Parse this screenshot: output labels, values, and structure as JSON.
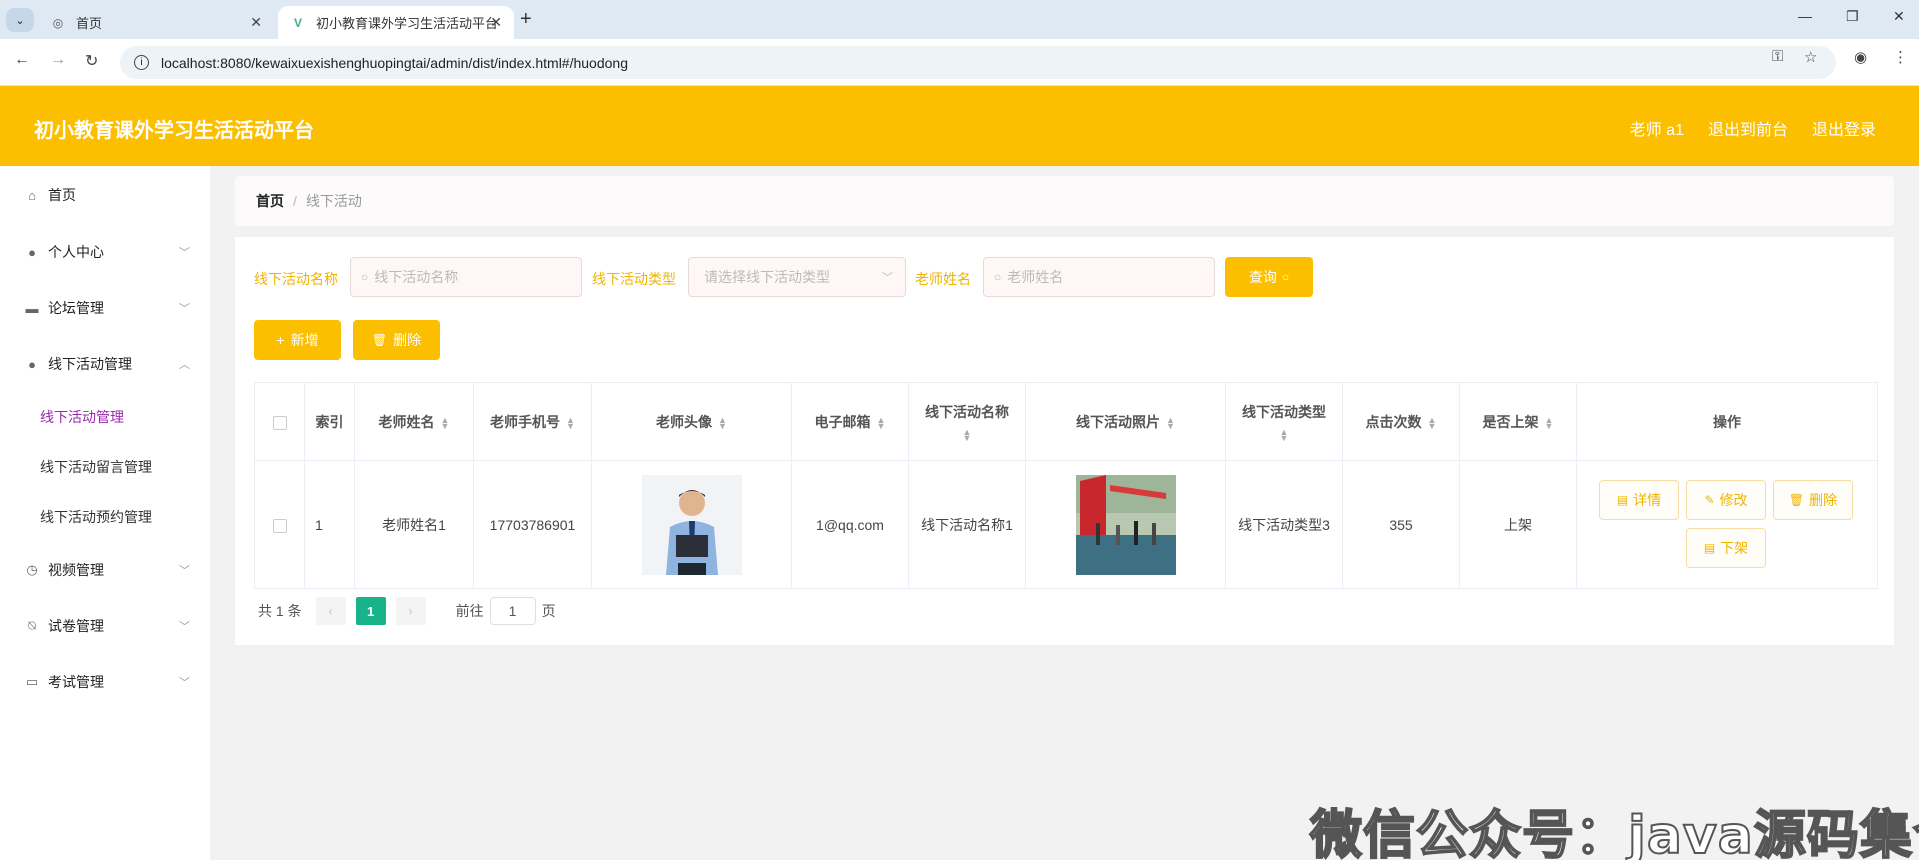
{
  "browser": {
    "tabs": [
      {
        "title": "首页"
      },
      {
        "title": "初小教育课外学习生活活动平台"
      }
    ],
    "url": "localhost:8080/kewaixuexishenghuopingtai/admin/dist/index.html#/huodong"
  },
  "header": {
    "title": "初小教育课外学习生活活动平台",
    "user": "老师 a1",
    "to_front": "退出到前台",
    "logout": "退出登录"
  },
  "sidebar": {
    "items": [
      {
        "label": "首页",
        "icon": "home-icon"
      },
      {
        "label": "个人中心",
        "icon": "user-icon"
      },
      {
        "label": "论坛管理",
        "icon": "ticket-icon"
      },
      {
        "label": "线下活动管理",
        "icon": "user-icon"
      },
      {
        "label": "视频管理",
        "icon": "compass-icon"
      },
      {
        "label": "试卷管理",
        "icon": "bell-off-icon"
      },
      {
        "label": "考试管理",
        "icon": "chat-icon"
      }
    ],
    "subitems": [
      "线下活动管理",
      "线下活动留言管理",
      "线下活动预约管理"
    ]
  },
  "breadcrumb": {
    "home": "首页",
    "sep": "/",
    "current": "线下活动"
  },
  "filters": {
    "name_label": "线下活动名称",
    "name_placeholder": "线下活动名称",
    "type_label": "线下活动类型",
    "type_placeholder": "请选择线下活动类型",
    "teacher_label": "老师姓名",
    "teacher_placeholder": "老师姓名",
    "query": "查询"
  },
  "actions": {
    "add": "新增",
    "delete": "删除"
  },
  "table": {
    "headers": [
      "索引",
      "老师姓名",
      "老师手机号",
      "老师头像",
      "电子邮箱",
      "线下活动名称",
      "线下活动照片",
      "线下活动类型",
      "点击次数",
      "是否上架",
      "操作"
    ],
    "rows": [
      {
        "index": "1",
        "teacher_name": "老师姓名1",
        "phone": "17703786901",
        "email": "1@qq.com",
        "activity_name": "线下活动名称1",
        "activity_type": "线下活动类型3",
        "clicks": "355",
        "on_shelf": "上架"
      }
    ],
    "op_labels": {
      "detail": "详情",
      "edit": "修改",
      "delete": "删除",
      "offshelf": "下架"
    }
  },
  "pagination": {
    "total": "共 1 条",
    "page": "1",
    "goto": "前往",
    "goto_value": "1",
    "page_unit": "页"
  },
  "watermark": "微信公众号：java源码集合",
  "colors": {
    "brand": "#fcbf00",
    "active_menu": "#9c27b0",
    "page_active": "#18b38a"
  }
}
